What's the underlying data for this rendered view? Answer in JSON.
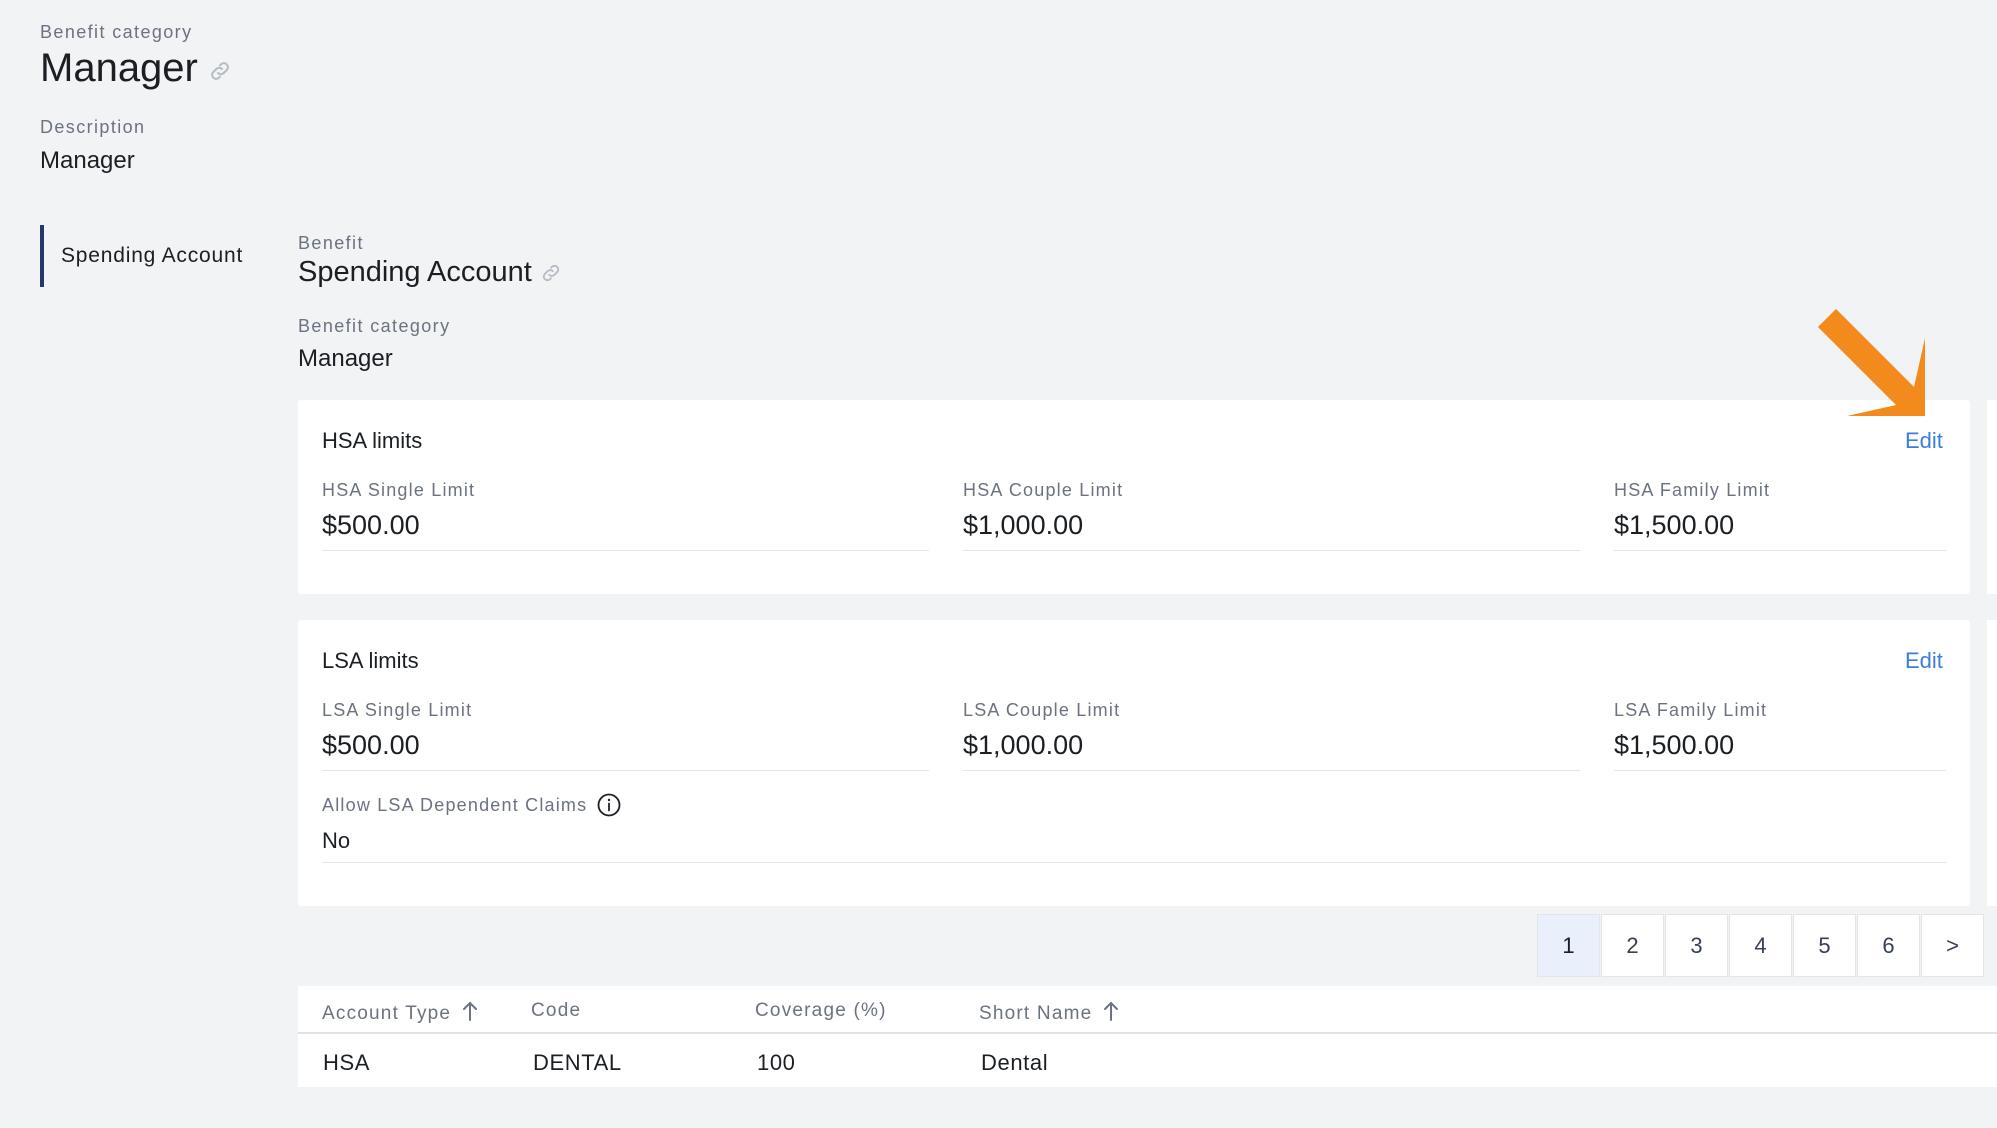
{
  "header": {
    "category_label": "Benefit category",
    "category_value": "Manager",
    "description_label": "Description",
    "description_value": "Manager"
  },
  "sidebar": {
    "items": [
      {
        "label": "Spending Account",
        "active": true
      }
    ]
  },
  "benefit": {
    "benefit_label": "Benefit",
    "benefit_value": "Spending Account",
    "category_label": "Benefit category",
    "category_value": "Manager"
  },
  "hsa": {
    "title": "HSA limits",
    "edit_label": "Edit",
    "fields": [
      {
        "label": "HSA Single Limit",
        "value": "$500.00"
      },
      {
        "label": "HSA Couple Limit",
        "value": "$1,000.00"
      },
      {
        "label": "HSA Family Limit",
        "value": "$1,500.00"
      }
    ]
  },
  "lsa": {
    "title": "LSA limits",
    "edit_label": "Edit",
    "fields": [
      {
        "label": "LSA Single Limit",
        "value": "$500.00"
      },
      {
        "label": "LSA Couple Limit",
        "value": "$1,000.00"
      },
      {
        "label": "LSA Family Limit",
        "value": "$1,500.00"
      }
    ],
    "dependent_claims_label": "Allow LSA Dependent Claims",
    "dependent_claims_value": "No"
  },
  "pagination": {
    "pages": [
      "1",
      "2",
      "3",
      "4",
      "5",
      "6"
    ],
    "current": "1",
    "next_label": ">"
  },
  "table": {
    "columns": [
      "Account Type",
      "Code",
      "Coverage (%)",
      "Short Name"
    ],
    "rows": [
      [
        "HSA",
        "DENTAL",
        "100",
        "Dental"
      ]
    ]
  },
  "colors": {
    "accent": "#3b7fd9",
    "sidebar_active_bar": "#1f3a6b",
    "annotation_arrow": "#f28a1c",
    "background": "#f2f3f5"
  },
  "icons": [
    "link-icon",
    "info-icon",
    "arrow-up-icon",
    "annotation-arrow"
  ]
}
